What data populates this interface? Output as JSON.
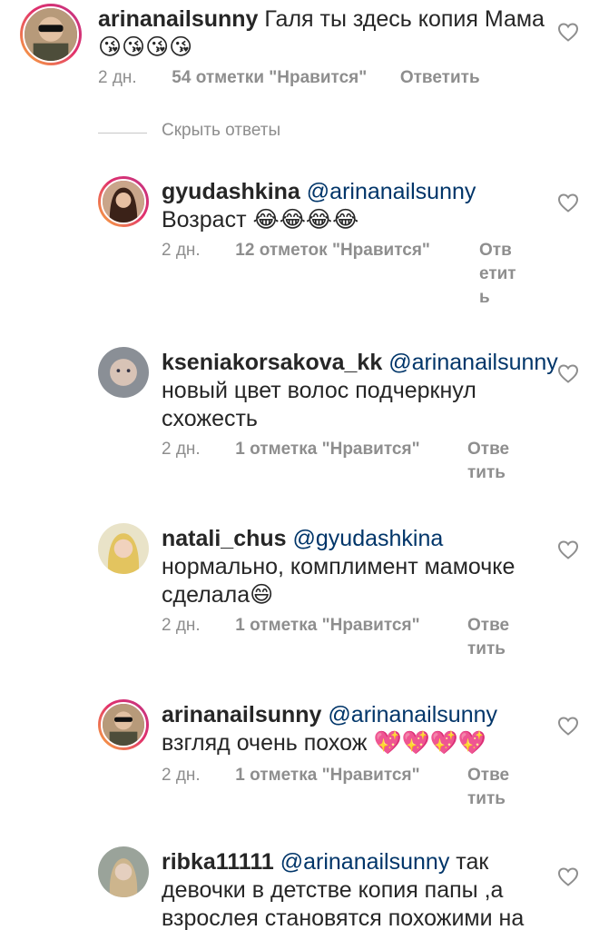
{
  "comments": [
    {
      "username": "arinanailsunny",
      "mention": "",
      "text": "Галя ты здесь копия Мама",
      "emojis": "😘😘😘😘",
      "time": "2 дн.",
      "likes": "54 отметки \"Нравится\"",
      "reply": "Ответить"
    },
    {
      "username": "gyudashkina",
      "mention": "@arinanailsunny",
      "text": "Возраст",
      "emojis": "😂😂😂😂",
      "time": "2 дн.",
      "likes": "12 отметок \"Нравится\"",
      "reply": "Ответить"
    },
    {
      "username": "kseniakorsakova_kk",
      "mention": "@arinanailsunny",
      "text": "новый цвет волос подчеркнул схожесть",
      "emojis": "",
      "time": "2 дн.",
      "likes": "1 отметка \"Нравится\"",
      "reply": "Ответить"
    },
    {
      "username": "natali_chus",
      "mention": "@gyudashkina",
      "text": "нормально, комплимент мамочке сделала",
      "emojis": "😄",
      "time": "2 дн.",
      "likes": "1 отметка \"Нравится\"",
      "reply": "Ответить"
    },
    {
      "username": "arinanailsunny",
      "mention": "@arinanailsunny",
      "text": "взгляд очень похож",
      "emojis": "💖💖💖💖",
      "time": "2 дн.",
      "likes": "1 отметка \"Нравится\"",
      "reply": "Ответить"
    },
    {
      "username": "ribka11111",
      "mention": "@arinanailsunny",
      "text": "так девочки в детстве копия папы ,а взрослея становятся похожими на",
      "emojis": "",
      "time": "",
      "likes": "",
      "reply": ""
    }
  ],
  "hide_replies": "Скрыть ответы",
  "icons": {
    "like": "heart-outline-icon"
  },
  "colors": {
    "text": "#262626",
    "meta": "#8e8e8e",
    "mention": "#003569",
    "ring_start": "#f9b03d",
    "ring_end": "#c13584"
  }
}
